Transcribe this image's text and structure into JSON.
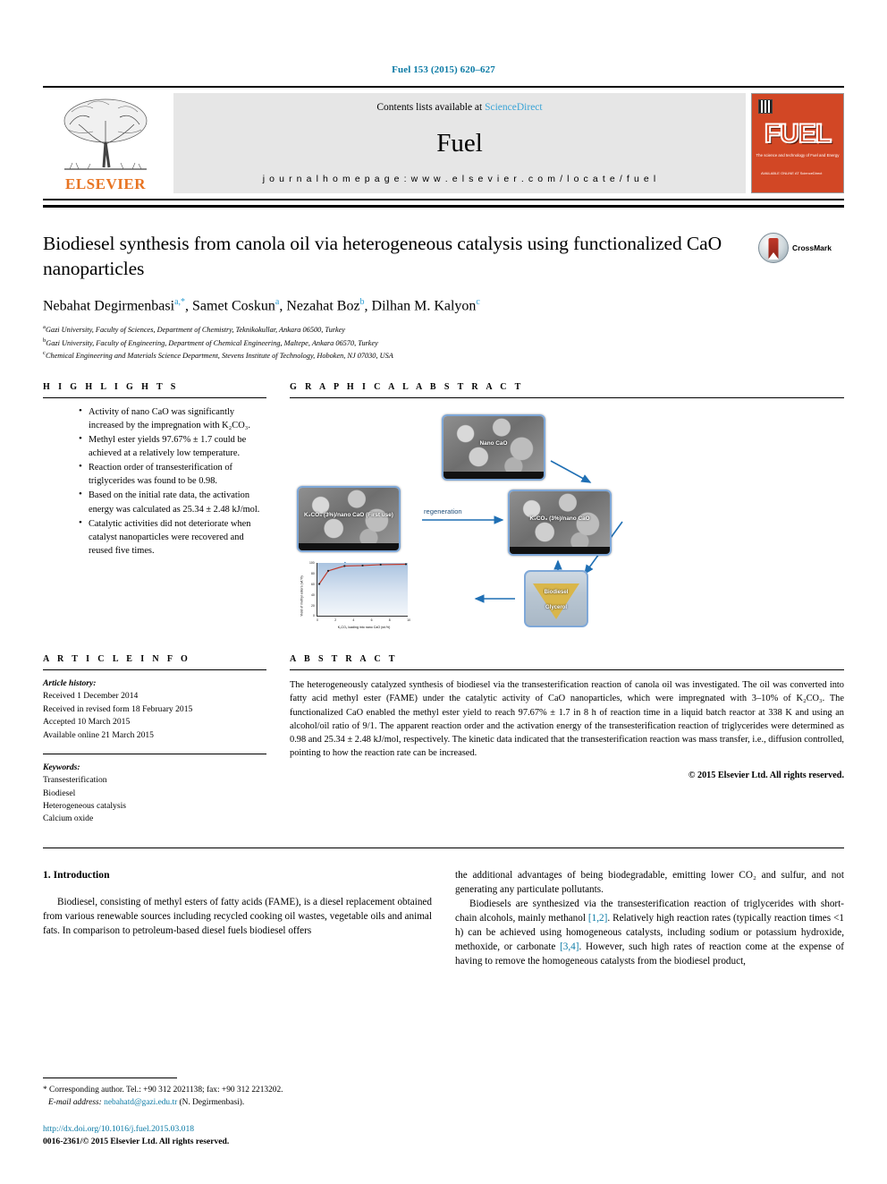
{
  "running_head": "Fuel 153 (2015) 620–627",
  "masthead": {
    "contents_prefix": "Contents lists available at ",
    "sciencedirect": "ScienceDirect",
    "journal_name": "Fuel",
    "homepage": "j o u r n a l   h o m e p a g e :   w w w . e l s e v i e r . c o m / l o c a t e / f u e l",
    "elsevier_wordmark": "ELSEVIER",
    "cover_title": "FUEL",
    "cover_subtitle": "The science and technology of Fuel and Energy",
    "cover_footer": "AVAILABLE ONLINE AT\nScienceDirect"
  },
  "title": "Biodiesel synthesis from canola oil via heterogeneous catalysis using functionalized CaO nanoparticles",
  "crossmark_label": "CrossMark",
  "authors": [
    {
      "name": "Nebahat Degirmenbasi",
      "marks": "a,*"
    },
    {
      "name": "Samet Coskun",
      "marks": "a"
    },
    {
      "name": "Nezahat Boz",
      "marks": "b"
    },
    {
      "name": "Dilhan M. Kalyon",
      "marks": "c"
    }
  ],
  "affiliations": [
    {
      "mark": "a",
      "text": "Gazi University, Faculty of Sciences, Department of Chemistry, Teknikokullar, Ankara 06500, Turkey"
    },
    {
      "mark": "b",
      "text": "Gazi University, Faculty of Engineering, Department of Chemical Engineering, Maltepe, Ankara 06570, Turkey"
    },
    {
      "mark": "c",
      "text": "Chemical Engineering and Materials Science Department, Stevens Institute of Technology, Hoboken, NJ 07030, USA"
    }
  ],
  "highlights": {
    "heading": "H I G H L I G H T S",
    "items": [
      "Activity of nano CaO was significantly increased by the impregnation with K2CO3.",
      "Methyl ester yields 97.67% ± 1.7 could be achieved at a relatively low temperature.",
      "Reaction order of transesterification of triglycerides was found to be 0.98.",
      "Based on the initial rate data, the activation energy was calculated as 25.34 ± 2.48 kJ/mol.",
      "Catalytic activities did not deteriorate when catalyst nanoparticles were recovered and reused five times."
    ]
  },
  "graphical_abstract": {
    "heading": "G R A P H I C A L   A B S T R A C T",
    "images": [
      {
        "id": "nano-cao",
        "caption": "Nano CaO"
      },
      {
        "id": "first-use",
        "caption": "K2CO3 (3%)/nano CaO\n(First use)"
      },
      {
        "id": "regenerated",
        "caption": "K2CO3 (3%)/nano CaO"
      }
    ],
    "regeneration_label": "regeneration",
    "funnel": {
      "top_label": "Biodiesel",
      "bottom_label": "Glycerol"
    },
    "chart_data": {
      "type": "line",
      "title": "",
      "xlabel": "K2CO3 loading into nano CaO (wt.%)",
      "ylabel": "Yield of methyl esters (wt.%)",
      "x": [
        0,
        1,
        3,
        5,
        7,
        10
      ],
      "values": [
        60,
        85,
        96,
        96.5,
        97,
        97.5
      ],
      "xlim": [
        0,
        10
      ],
      "ylim": [
        0,
        100
      ],
      "xticks": [
        "0",
        "2",
        "4",
        "6",
        "8",
        "10"
      ],
      "yticks": [
        "0",
        "20",
        "40",
        "60",
        "80",
        "100"
      ],
      "grid": false,
      "line_color": "#c0392b",
      "area_color": "#aac3e0"
    }
  },
  "article_info": {
    "heading": "A R T I C L E   I N F O",
    "history_label": "Article history:",
    "history": [
      "Received 1 December 2014",
      "Received in revised form 18 February 2015",
      "Accepted 10 March 2015",
      "Available online 21 March 2015"
    ],
    "keywords_label": "Keywords:",
    "keywords": [
      "Transesterification",
      "Biodiesel",
      "Heterogeneous catalysis",
      "Calcium oxide"
    ]
  },
  "abstract": {
    "heading": "A B S T R A C T",
    "text": "The heterogeneously catalyzed synthesis of biodiesel via the transesterification reaction of canola oil was investigated. The oil was converted into fatty acid methyl ester (FAME) under the catalytic activity of CaO nanoparticles, which were impregnated with 3–10% of K2CO3. The functionalized CaO enabled the methyl ester yield to reach 97.67% ± 1.7 in 8 h of reaction time in a liquid batch reactor at 338 K and using an alcohol/oil ratio of 9/1. The apparent reaction order and the activation energy of the transesterification reaction of triglycerides were determined as 0.98 and 25.34 ± 2.48 kJ/mol, respectively. The kinetic data indicated that the transesterification reaction was mass transfer, i.e., diffusion controlled, pointing to how the reaction rate can be increased.",
    "copyright": "© 2015 Elsevier Ltd. All rights reserved."
  },
  "introduction": {
    "heading": "1. Introduction",
    "left_paragraph": "Biodiesel, consisting of methyl esters of fatty acids (FAME), is a diesel replacement obtained from various renewable sources including recycled cooking oil wastes, vegetable oils and animal fats. In comparison to petroleum-based diesel fuels biodiesel offers",
    "right_paragraph_1": "the additional advantages of being biodegradable, emitting lower CO2 and sulfur, and not generating any particulate pollutants.",
    "right_paragraph_2_a": "Biodiesels are synthesized via the transesterification reaction of triglycerides with short-chain alcohols, mainly methanol ",
    "right_ref_1": "[1,2]",
    "right_paragraph_2_b": ". Relatively high reaction rates (typically reaction times <1 h) can be achieved using homogeneous catalysts, including sodium or potassium hydroxide, methoxide, or carbonate ",
    "right_ref_2": "[3,4]",
    "right_paragraph_2_c": ". However, such high rates of reaction come at the expense of having to remove the homogeneous catalysts from the biodiesel product,"
  },
  "footnotes": {
    "corresponding": "* Corresponding author. Tel.: +90 312 2021138; fax: +90 312 2213202.",
    "email_label": "E-mail address:",
    "email": "nebahatd@gazi.edu.tr",
    "email_suffix": "(N. Degirmenbasi).",
    "doi": "http://dx.doi.org/10.1016/j.fuel.2015.03.018",
    "issn": "0016-2361/© 2015 Elsevier Ltd. All rights reserved."
  }
}
